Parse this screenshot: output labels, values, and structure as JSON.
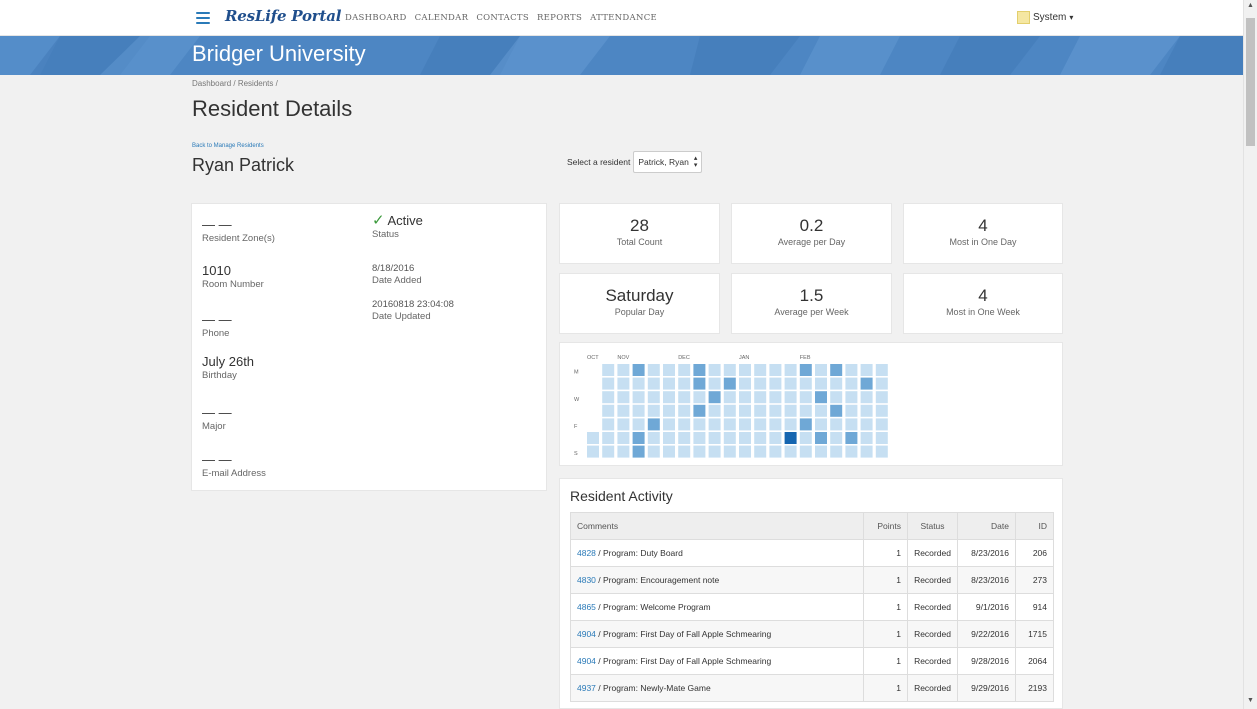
{
  "nav": {
    "brand": "ResLife Portal",
    "links": [
      "DASHBOARD",
      "CALENDAR",
      "CONTACTS",
      "REPORTS",
      "ATTENDANCE"
    ],
    "user": "System"
  },
  "banner": {
    "title": "Bridger University"
  },
  "breadcrumb": {
    "items": [
      "Dashboard /",
      "Residents /"
    ]
  },
  "page": {
    "title": "Resident Details",
    "back_link": "Back to Manage Residents",
    "resident_name": "Ryan Patrick",
    "select_label": "Select a resident",
    "select_value": "Patrick, Ryan"
  },
  "info": {
    "zone": {
      "value": "— —",
      "label": "Resident Zone(s)"
    },
    "room": {
      "value": "1010",
      "label": "Room Number"
    },
    "phone": {
      "value": "— —",
      "label": "Phone"
    },
    "birthday": {
      "value": "July 26th",
      "label": "Birthday"
    },
    "major": {
      "value": "— —",
      "label": "Major"
    },
    "email": {
      "value": "— —",
      "label": "E-mail Address"
    },
    "status": {
      "value": "Active",
      "label": "Status"
    },
    "date_added": {
      "value": "8/18/2016",
      "label": "Date Added"
    },
    "date_updated": {
      "value": "20160818 23:04:08",
      "label": "Date Updated"
    }
  },
  "stats": [
    {
      "value": "28",
      "caption": "Total Count"
    },
    {
      "value": "0.2",
      "caption": "Average per Day"
    },
    {
      "value": "4",
      "caption": "Most in One Day"
    },
    {
      "value": "Saturday",
      "caption": "Popular Day"
    },
    {
      "value": "1.5",
      "caption": "Average per Week"
    },
    {
      "value": "4",
      "caption": "Most in One Week"
    }
  ],
  "heatmap": {
    "months": [
      "OCT",
      "NOV",
      "DEC",
      "JAN",
      "FEB"
    ],
    "month_weeks": [
      0,
      2,
      6,
      10,
      14
    ],
    "day_labels": [
      "M",
      "W",
      "F",
      "S"
    ],
    "day_label_rows": [
      1,
      3,
      5,
      7
    ],
    "colors": {
      "empty": "#c6dff2",
      "level1": "#6fa8d6",
      "level2": "#1565b0"
    },
    "weeks": [
      [
        0,
        0,
        0,
        0,
        0,
        0,
        0
      ],
      [
        0,
        0,
        0,
        0,
        0,
        0,
        0
      ],
      [
        0,
        0,
        0,
        0,
        0,
        0,
        0
      ],
      [
        1,
        0,
        0,
        0,
        0,
        1,
        1
      ],
      [
        0,
        0,
        0,
        0,
        1,
        0,
        0
      ],
      [
        0,
        0,
        0,
        0,
        0,
        0,
        0
      ],
      [
        0,
        0,
        0,
        0,
        0,
        0,
        0
      ],
      [
        1,
        1,
        0,
        1,
        0,
        0,
        0
      ],
      [
        0,
        0,
        1,
        0,
        0,
        0,
        0
      ],
      [
        0,
        1,
        0,
        0,
        0,
        0,
        0
      ],
      [
        0,
        0,
        0,
        0,
        0,
        0,
        0
      ],
      [
        0,
        0,
        0,
        0,
        0,
        0,
        0
      ],
      [
        0,
        0,
        0,
        0,
        0,
        0,
        0
      ],
      [
        0,
        0,
        0,
        0,
        0,
        2,
        0
      ],
      [
        1,
        0,
        0,
        0,
        1,
        0,
        0
      ],
      [
        0,
        0,
        1,
        0,
        0,
        1,
        0
      ],
      [
        1,
        0,
        0,
        1,
        0,
        0,
        0
      ],
      [
        0,
        0,
        0,
        0,
        0,
        1,
        0
      ],
      [
        0,
        1,
        0,
        0,
        0,
        0,
        0
      ],
      [
        0,
        0,
        0,
        0,
        0,
        0,
        0
      ]
    ]
  },
  "activity": {
    "title": "Resident Activity",
    "columns": [
      "Comments",
      "Points",
      "Status",
      "Date",
      "ID"
    ],
    "rows": [
      {
        "id_link": "4828",
        "comment": " / Program: Duty Board",
        "points": "1",
        "status": "Recorded",
        "date": "8/23/2016",
        "id": "206"
      },
      {
        "id_link": "4830",
        "comment": " / Program: Encouragement note",
        "points": "1",
        "status": "Recorded",
        "date": "8/23/2016",
        "id": "273"
      },
      {
        "id_link": "4865",
        "comment": " / Program: Welcome Program",
        "points": "1",
        "status": "Recorded",
        "date": "9/1/2016",
        "id": "914"
      },
      {
        "id_link": "4904",
        "comment": " / Program: First Day of Fall Apple Schmearing",
        "points": "1",
        "status": "Recorded",
        "date": "9/22/2016",
        "id": "1715"
      },
      {
        "id_link": "4904",
        "comment": " / Program: First Day of Fall Apple Schmearing",
        "points": "1",
        "status": "Recorded",
        "date": "9/28/2016",
        "id": "2064"
      },
      {
        "id_link": "4937",
        "comment": " / Program: Newly-Mate Game",
        "points": "1",
        "status": "Recorded",
        "date": "9/29/2016",
        "id": "2193"
      }
    ]
  }
}
